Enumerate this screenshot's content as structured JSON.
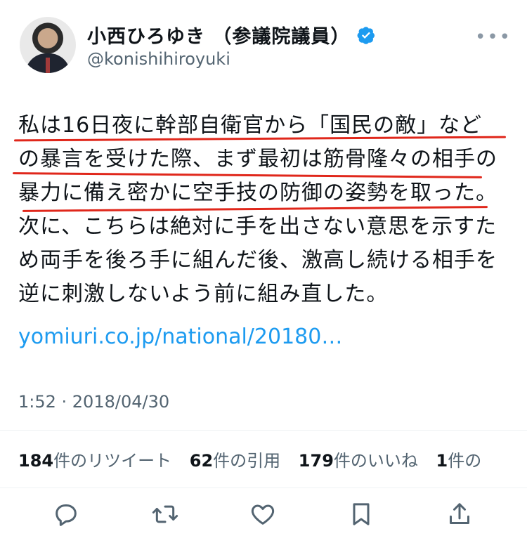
{
  "user": {
    "display_name": "小西ひろゆき （参議院議員）",
    "handle": "@konishihiroyuki"
  },
  "tweet": {
    "lines": [
      "私は16日夜に幹部自衛官から「国民の敵」など",
      "の暴言を受けた際、まず最初は筋骨隆々の相手の",
      "暴力に備え密かに空手技の防御の姿勢を取った。",
      "次に、こちらは絶対に手を出さない意思を示すた",
      "め両手を後ろ手に組んだ後、激高し続ける相手を",
      "逆に刺激しないよう前に組み直した。"
    ],
    "link": "yomiuri.co.jp/national/20180…",
    "timestamp": "1:52 · 2018/04/30"
  },
  "stats": {
    "retweets_count": "184",
    "retweets_label": "件のリツイート",
    "quotes_count": "62",
    "quotes_label": "件の引用",
    "likes_count": "179",
    "likes_label": "件のいいね",
    "bookmarks_count": "1",
    "bookmarks_label": "件の"
  },
  "actions": {
    "icons": [
      "reply-icon",
      "retweet-icon",
      "like-icon",
      "bookmark-icon",
      "share-icon"
    ]
  },
  "colors": {
    "link": "#1d9bf0",
    "underline": "#e0271b",
    "verified": "#1d9bf0",
    "muted": "#536471"
  }
}
